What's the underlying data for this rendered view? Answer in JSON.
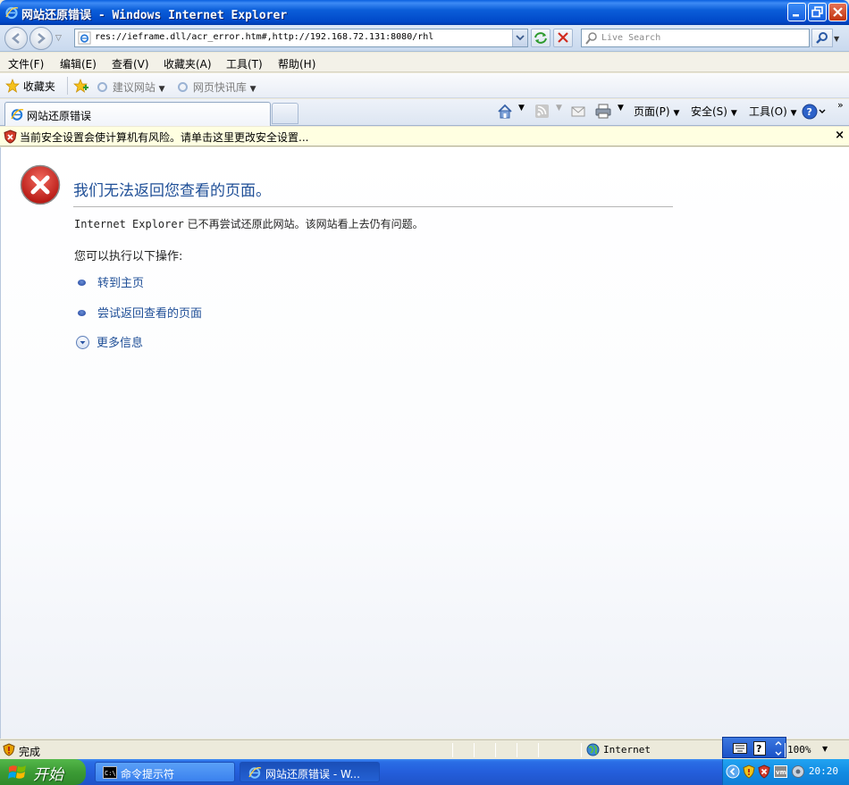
{
  "window": {
    "title": "网站还原错误 - Windows Internet Explorer"
  },
  "address_bar": {
    "url": "res://ieframe.dll/acr_error.htm#,http://192.168.72.131:8080/rhl",
    "search_placeholder": "Live Search"
  },
  "menu": {
    "items": [
      "文件(F)",
      "编辑(E)",
      "查看(V)",
      "收藏夹(A)",
      "工具(T)",
      "帮助(H)"
    ]
  },
  "favorites_bar": {
    "favorites_label": "收藏夹",
    "suggested_sites": "建议网站",
    "web_slice_gallery": "网页快讯库"
  },
  "tabs": {
    "active_tab_label": "网站还原错误"
  },
  "command_bar": {
    "page_label": "页面(P)",
    "safety_label": "安全(S)",
    "tools_label": "工具(O)"
  },
  "info_bar": {
    "message": "当前安全设置会使计算机有风险。请单击这里更改安全设置..."
  },
  "error_page": {
    "title": "我们无法返回您查看的页面。",
    "description_prefix": "Internet Explorer",
    "description_rest": " 已不再尝试还原此网站。该网站看上去仍有问题。",
    "actions_heading": "您可以执行以下操作:",
    "links": [
      {
        "label": "转到主页"
      },
      {
        "label": "尝试返回查看的页面"
      }
    ],
    "more_info_label": "更多信息"
  },
  "status_bar": {
    "status_text": "完成",
    "zone_label": "Internet",
    "zoom_label": "100%"
  },
  "taskbar": {
    "start_label": "开始",
    "items": [
      {
        "label": "命令提示符"
      },
      {
        "label": "网站还原错误 - W..."
      }
    ],
    "clock": "20:20"
  },
  "colors": {
    "title_bar": "#0b5ed9",
    "link": "#1f4f97",
    "info_bar_bg": "#ffffe1",
    "error_red": "#d2231e"
  }
}
